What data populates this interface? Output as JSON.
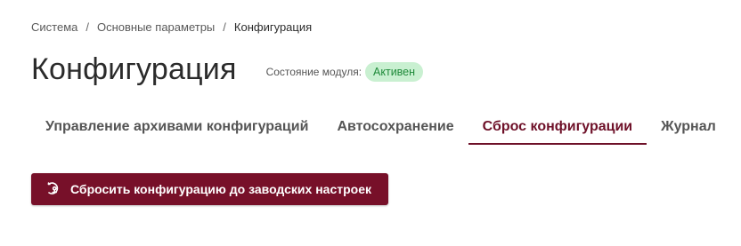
{
  "breadcrumb": {
    "items": [
      "Система",
      "Основные параметры",
      "Конфигурация"
    ],
    "separator": "/"
  },
  "page": {
    "title": "Конфигурация",
    "module_state_label": "Состояние модуля:",
    "module_state_value": "Активен"
  },
  "tabs": [
    {
      "label": "Управление архивами конфигураций",
      "active": false
    },
    {
      "label": "Автосохранение",
      "active": false
    },
    {
      "label": "Сброс конфигурации",
      "active": true
    },
    {
      "label": "Журнал",
      "active": false
    }
  ],
  "actions": {
    "reset_label": "Сбросить конфигурацию до заводских настроек",
    "reset_icon": "factory-reset-icon"
  },
  "colors": {
    "accent": "#771029",
    "badge_bg": "#c9f0d1",
    "badge_text": "#1f8a3a"
  }
}
